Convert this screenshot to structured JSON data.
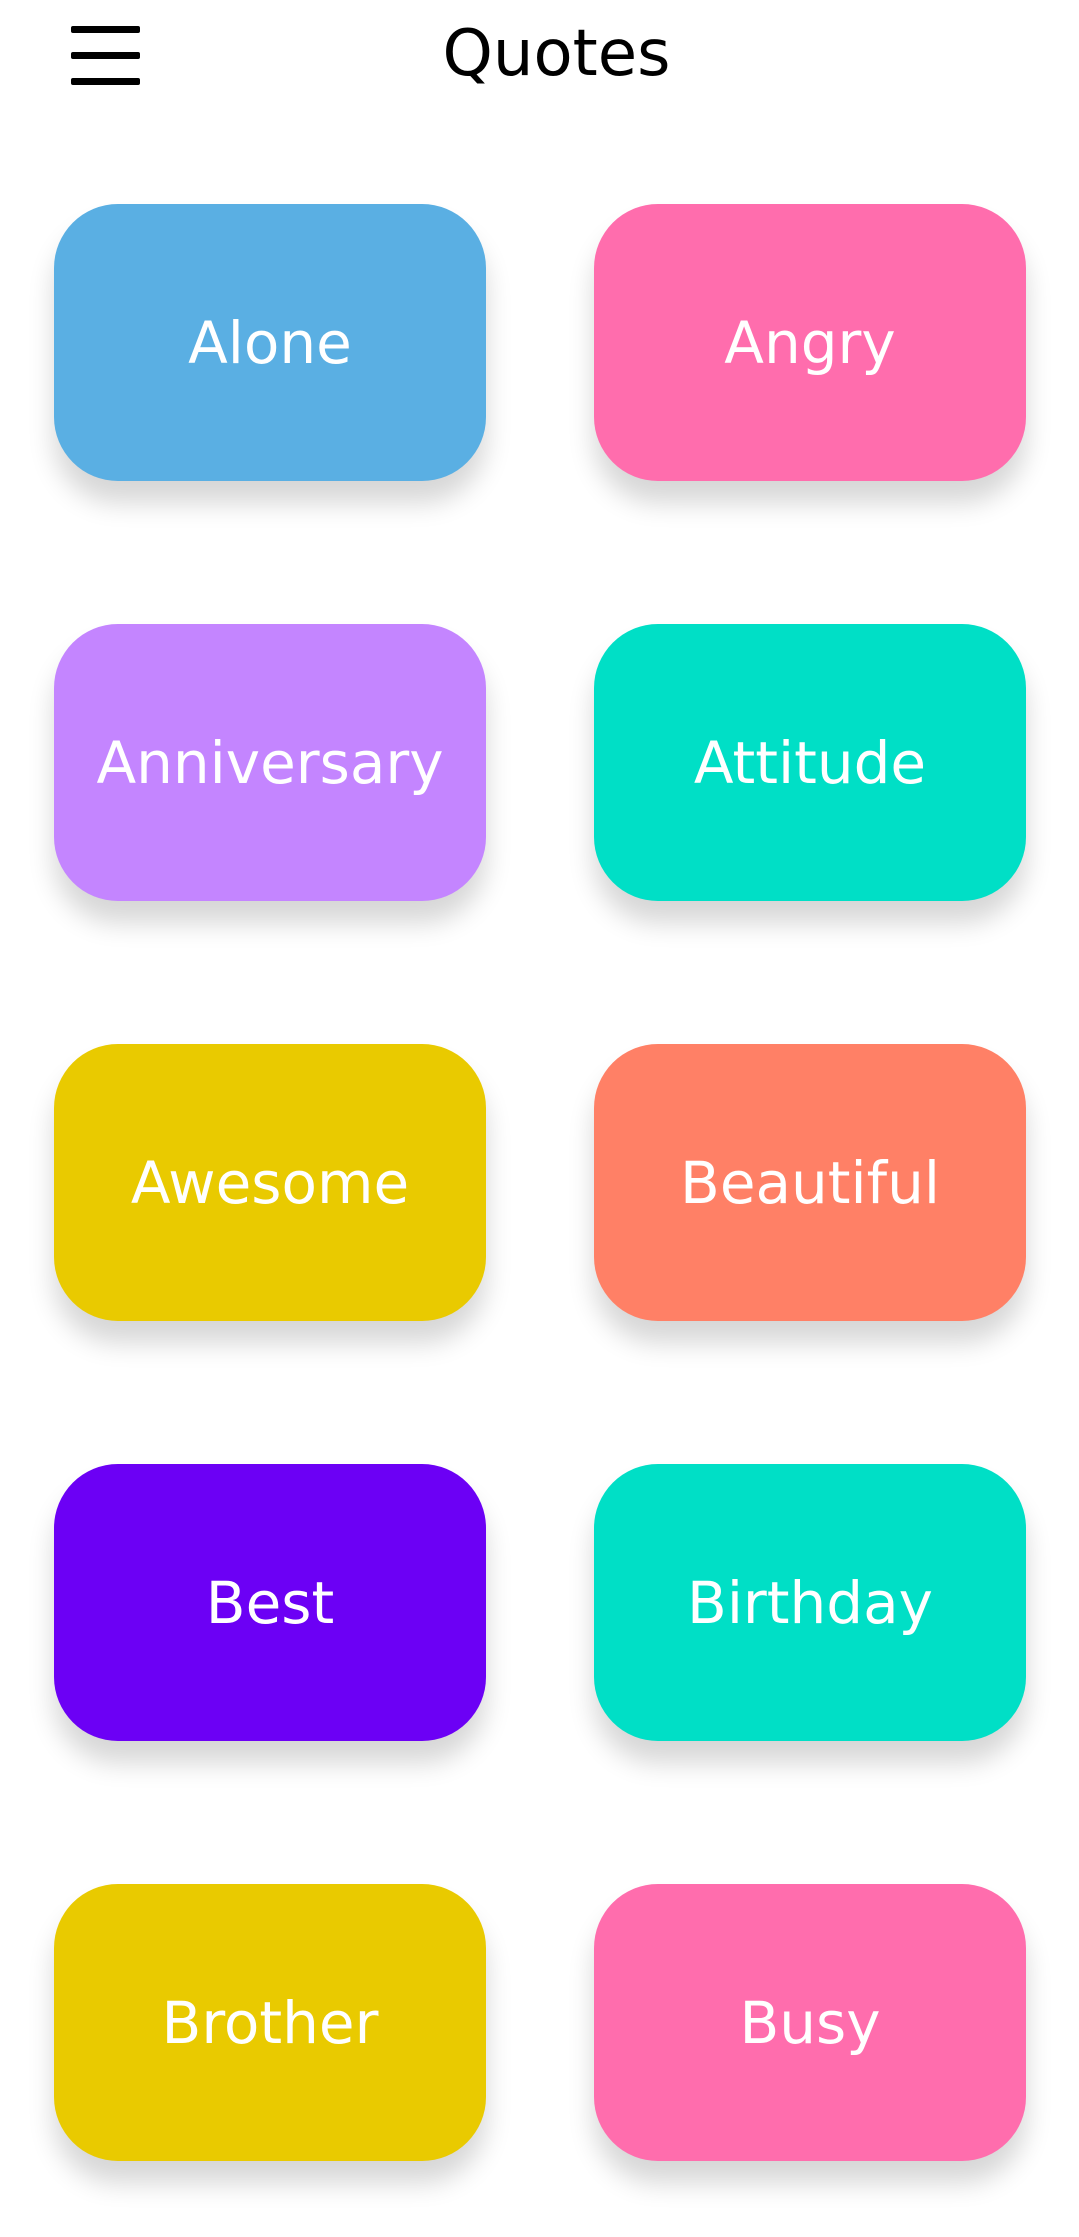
{
  "header": {
    "title": "Quotes",
    "menu_icon": "hamburger-menu-icon"
  },
  "categories": [
    {
      "label": "Alone",
      "color": "#5AAFE3"
    },
    {
      "label": "Angry",
      "color": "#FF6DAD"
    },
    {
      "label": "Anniversary",
      "color": "#C485FF"
    },
    {
      "label": "Attitude",
      "color": "#00DFC6"
    },
    {
      "label": "Awesome",
      "color": "#E9CA00"
    },
    {
      "label": "Beautiful",
      "color": "#FF8066"
    },
    {
      "label": "Best",
      "color": "#6C00F5"
    },
    {
      "label": "Birthday",
      "color": "#00DFC6"
    },
    {
      "label": "Brother",
      "color": "#E9CA00"
    },
    {
      "label": "Busy",
      "color": "#FF6DAD"
    }
  ]
}
